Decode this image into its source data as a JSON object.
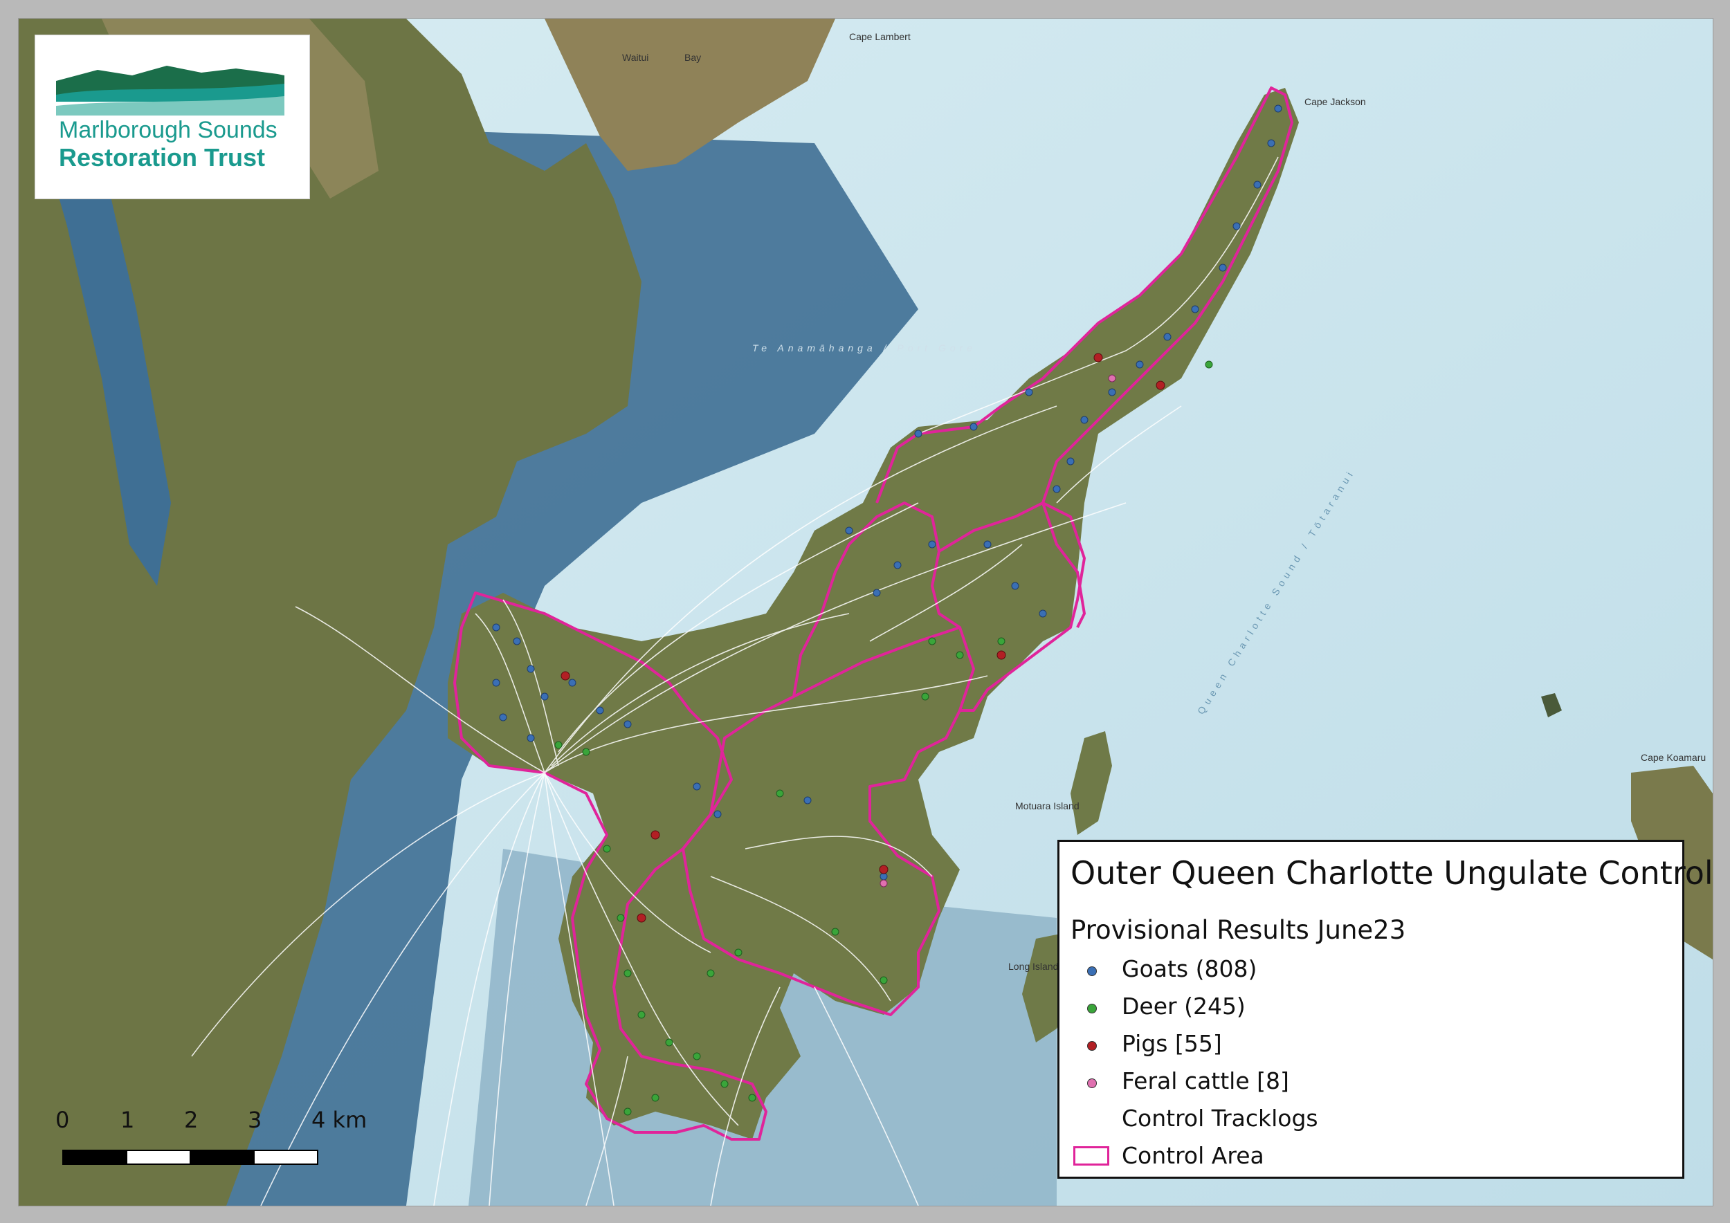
{
  "logo": {
    "line1": "Marlborough Sounds",
    "line2": "Restoration Trust",
    "colors": {
      "dark_green": "#1b6e4a",
      "teal": "#1a9a8e",
      "light_teal": "#7cc9bf"
    }
  },
  "map": {
    "place_labels": [
      "Cape Lambert",
      "Waitui",
      "Bay",
      "Cape Jackson",
      "Te Anamāhanga / Port Gore",
      "Motuara Island",
      "Long Island",
      "Queen Charlotte Sound / Tōtaranui",
      "Cape Koamaru"
    ],
    "colors": {
      "sea_light": "#cfe6ee",
      "sea_deep": "#3e6f95",
      "land": "#6f7747",
      "land_light": "#8f8a5e",
      "control_area": "#e0249a",
      "tracklog": "#ffffff"
    }
  },
  "legend": {
    "title": "Outer Queen Charlotte Ungulate Control",
    "subtitle": "Provisional Results June23",
    "items": [
      {
        "label": "Goats (808)",
        "color": "#3a6fb5",
        "symbol": "dot"
      },
      {
        "label": "Deer (245)",
        "color": "#3aa53a",
        "symbol": "dot"
      },
      {
        "label": "Pigs  [55]",
        "color": "#b21f24",
        "symbol": "dot"
      },
      {
        "label": "Feral cattle  [8]",
        "color": "#e070b0",
        "symbol": "dot"
      },
      {
        "label": "Control Tracklogs",
        "color": "#ffffff",
        "symbol": "line"
      },
      {
        "label": "Control Area",
        "color": "#e0249a",
        "symbol": "box"
      }
    ]
  },
  "scale": {
    "ticks": [
      "0",
      "1",
      "2",
      "3",
      "4 km"
    ]
  }
}
